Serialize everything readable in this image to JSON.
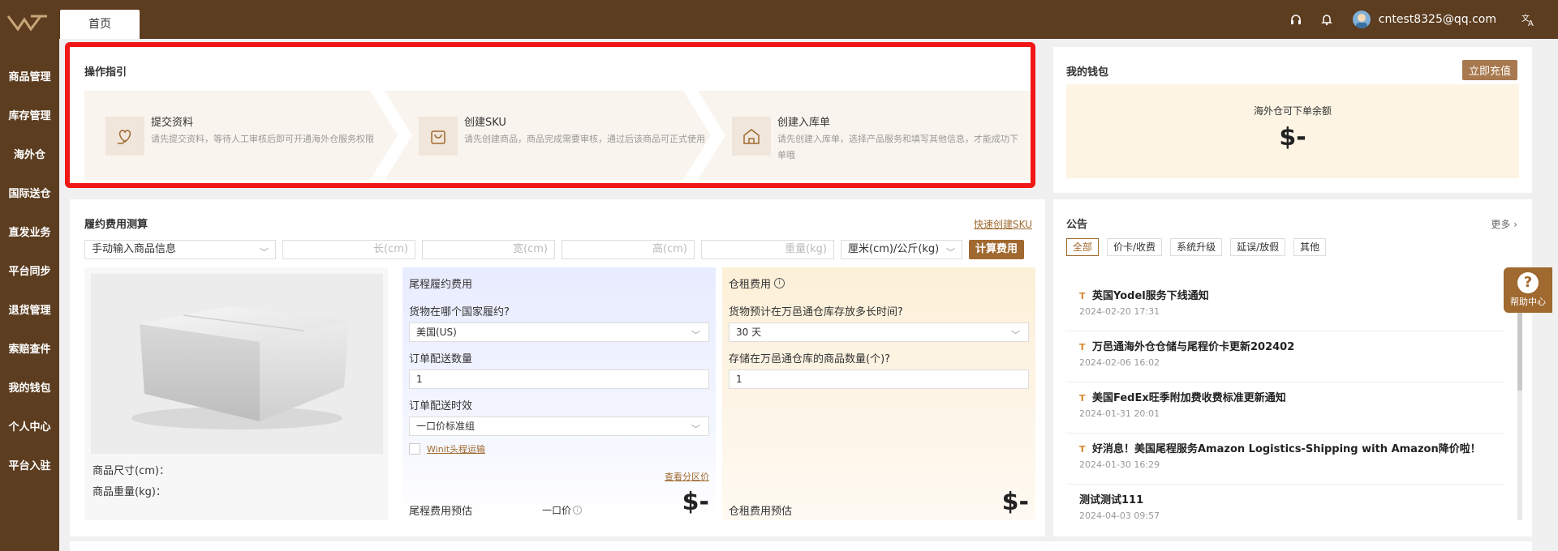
{
  "topbar": {
    "home_tab": "首页",
    "user_email": "cntest8325@qq.com"
  },
  "sidebar": {
    "items": [
      "商品管理",
      "库存管理",
      "海外仓",
      "国际送仓",
      "直发业务",
      "平台同步",
      "退货管理",
      "索赔查件",
      "我的钱包",
      "个人中心",
      "平台入驻"
    ]
  },
  "guide": {
    "title": "操作指引",
    "steps": [
      {
        "title": "提交资料",
        "desc": "请先提交资料，等待人工审核后即可开通海外仓服务权限"
      },
      {
        "title": "创建SKU",
        "desc": "请先创建商品，商品完成需要审核，通过后该商品可正式使用"
      },
      {
        "title": "创建入库单",
        "desc": "请先创建入库单，选择产品服务和填写其他信息，才能成功下单哦"
      }
    ]
  },
  "wallet": {
    "title": "我的钱包",
    "recharge": "立即充值",
    "label": "海外仓可下单余额",
    "amount": "$-"
  },
  "calc": {
    "title": "履约费用测算",
    "quick_create": "快速创建SKU",
    "input_mode": "手动输入商品信息",
    "length_ph": "长(cm)",
    "width_ph": "宽(cm)",
    "height_ph": "高(cm)",
    "weight_ph": "重量(kg)",
    "unit": "厘米(cm)/公斤(kg)",
    "calc_btn": "计算费用",
    "size_label": "商品尺寸(cm)：",
    "weight_label": "商品重量(kg)：",
    "tail": {
      "title": "尾程履约费用",
      "q_country": "货物在哪个国家履约?",
      "country": "美国(US)",
      "q_qty": "订单配送数量",
      "qty": "1",
      "q_speed": "订单配送时效",
      "speed": "一口价标准组",
      "winit": "Winit头程运输",
      "zone_link": "查看分区价",
      "estimate_label": "尾程费用预估",
      "price_type": "一口价",
      "amount": "$-"
    },
    "storage": {
      "title": "仓租费用",
      "q_days": "货物预计在万邑通仓库存放多长时间?",
      "days": "30 天",
      "q_count": "存储在万邑通仓库的商品数量(个)?",
      "count": "1",
      "estimate_label": "仓租费用预估",
      "amount": "$-"
    }
  },
  "notice": {
    "title": "公告",
    "more": "更多",
    "tags": [
      "全部",
      "价卡/收费",
      "系统升级",
      "延误/放假",
      "其他"
    ],
    "items": [
      {
        "title": "英国Yodel服务下线通知",
        "date": "2024-02-20 17:31"
      },
      {
        "title": "万邑通海外仓仓储与尾程价卡更新202402",
        "date": "2024-02-06 16:02"
      },
      {
        "title": "美国FedEx旺季附加费收费标准更新通知",
        "date": "2024-01-31 20:01"
      },
      {
        "title": "好消息！美国尾程服务Amazon Logistics-Shipping with Amazon降价啦！",
        "date": "2024-01-30 16:29"
      },
      {
        "title": "测试测试111",
        "date": "2024-04-03 09:57"
      }
    ]
  },
  "help": {
    "label": "帮助中心"
  },
  "colors": {
    "brand": "#5c3d20",
    "accent": "#a0692f",
    "highlight": "#f11717"
  }
}
